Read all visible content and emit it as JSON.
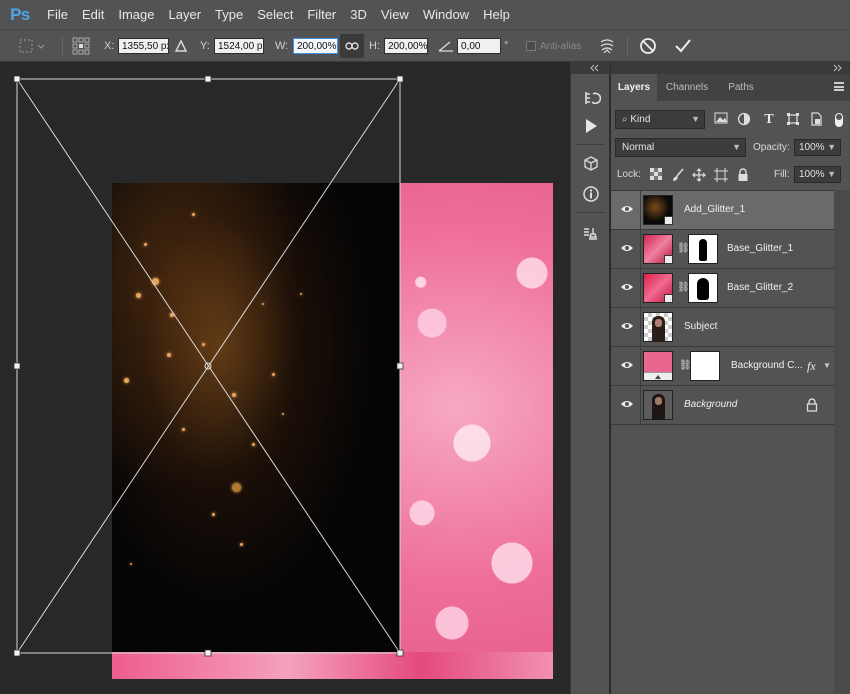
{
  "app": {
    "logo": "Ps"
  },
  "menu": [
    "File",
    "Edit",
    "Image",
    "Layer",
    "Type",
    "Select",
    "Filter",
    "3D",
    "View",
    "Window",
    "Help"
  ],
  "options": {
    "x_label": "X:",
    "x_value": "1355,50 px",
    "y_label": "Y:",
    "y_value": "1524,00 px",
    "w_label": "W:",
    "w_value": "200,00%",
    "h_label": "H:",
    "h_value": "200,00%",
    "angle_value": "0,00",
    "angle_unit": "°",
    "antialias_label": "Anti-alias"
  },
  "panel": {
    "tabs": [
      "Layers",
      "Channels",
      "Paths"
    ],
    "kind": "Kind",
    "blend_mode": "Normal",
    "opacity_label": "Opacity:",
    "opacity_value": "100%",
    "lock_label": "Lock:",
    "fill_label": "Fill:",
    "fill_value": "100%"
  },
  "layers": [
    {
      "name": "Add_Glitter_1",
      "selected": true,
      "italic": false
    },
    {
      "name": "Base_Glitter_1",
      "selected": false,
      "italic": false
    },
    {
      "name": "Base_Glitter_2",
      "selected": false,
      "italic": false
    },
    {
      "name": "Subject",
      "selected": false,
      "italic": false
    },
    {
      "name": "Background C...",
      "selected": false,
      "italic": false,
      "fx": "fx"
    },
    {
      "name": "Background",
      "selected": false,
      "italic": true
    }
  ],
  "colors": {
    "ui_bg": "#535353",
    "canvas_bg": "#282828",
    "accent": "#3e8fe6",
    "pink_fill": "#e9678f"
  }
}
